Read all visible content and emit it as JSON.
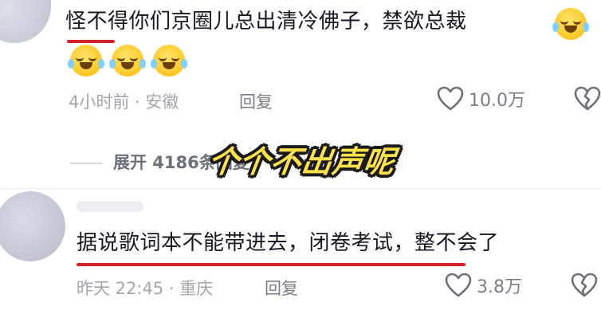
{
  "comments": [
    {
      "text": "怪不得你们京圈儿总出清冷佛子，禁欲总裁",
      "meta": "4小时前 · 安徽",
      "reply_label": "回复",
      "likes": "10.0万",
      "emoji_count": 4
    },
    {
      "text": "据说歌词本不能带进去，闭卷考试，整不会了",
      "meta": "昨天 22:45 · 重庆",
      "reply_label": "回复",
      "likes": "3.8万"
    }
  ],
  "expand_replies": "展开 4186条回复",
  "overlay_caption": "个个不出声呢",
  "colors": {
    "underline": "#d61f2b",
    "caption_fill": "#ffe24a",
    "text_primary": "#161823",
    "text_meta": "#a4a6ad"
  },
  "icons": {
    "like": "heart-outline-icon",
    "dislike": "broken-heart-icon",
    "emoji": "laugh-cry-emoji-icon"
  }
}
